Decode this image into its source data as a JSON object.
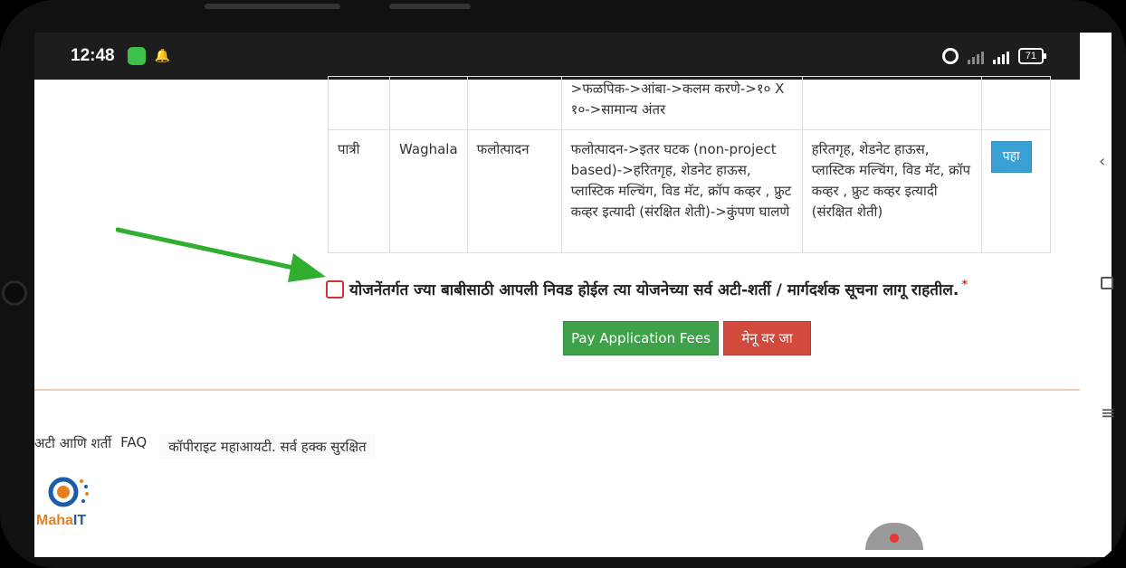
{
  "status_bar": {
    "time": "12:48",
    "battery": "71"
  },
  "table": {
    "rows": [
      {
        "col1": "",
        "col2": "",
        "col3": "",
        "col4": ">फळपिक->आंबा->कलम करणे->१० X १०->सामान्य अंतर",
        "col5": "",
        "col6": ""
      },
      {
        "col1": "पात्री",
        "col2": "Waghala",
        "col3": "फलोत्पादन",
        "col4": "फलोत्पादन->इतर घटक (non-project based)->हरितगृह, शेडनेट हाऊस, प्लास्टिक मल्चिंग, विड मॅट, क्रॉप कव्हर , फ्रुट कव्हर इत्यादी (संरक्षित शेती)->कुंपण घालणे",
        "col5": "हरितगृह, शेडनेट हाऊस, प्लास्टिक मल्चिंग, विड मॅट, क्रॉप कव्हर , फ्रुट कव्हर इत्यादी (संरक्षित शेती)",
        "view_label": "पहा"
      }
    ]
  },
  "agreement": {
    "text": "योजनेंतर्गत ज्या बाबीसाठी आपली निवड होईल त्या योजनेच्या सर्व अटी-शर्ती / मार्गदर्शक सूचना लागू राहतील.",
    "required_mark": "*"
  },
  "buttons": {
    "pay_label": "Pay Application Fees",
    "menu_label": "मेनू वर जा"
  },
  "footer": {
    "terms": "अटी आणि शर्ती",
    "faq": "FAQ",
    "copyright": "कॉपीराइट महाआयटी. सर्व हक्क सुरक्षित"
  },
  "logo": {
    "name_part1": "Maha",
    "name_part2": "IT"
  },
  "colors": {
    "pay_button": "#3fa14a",
    "menu_button": "#d24a3c",
    "view_button": "#3aa0d4",
    "arrow": "#2fae2f"
  }
}
